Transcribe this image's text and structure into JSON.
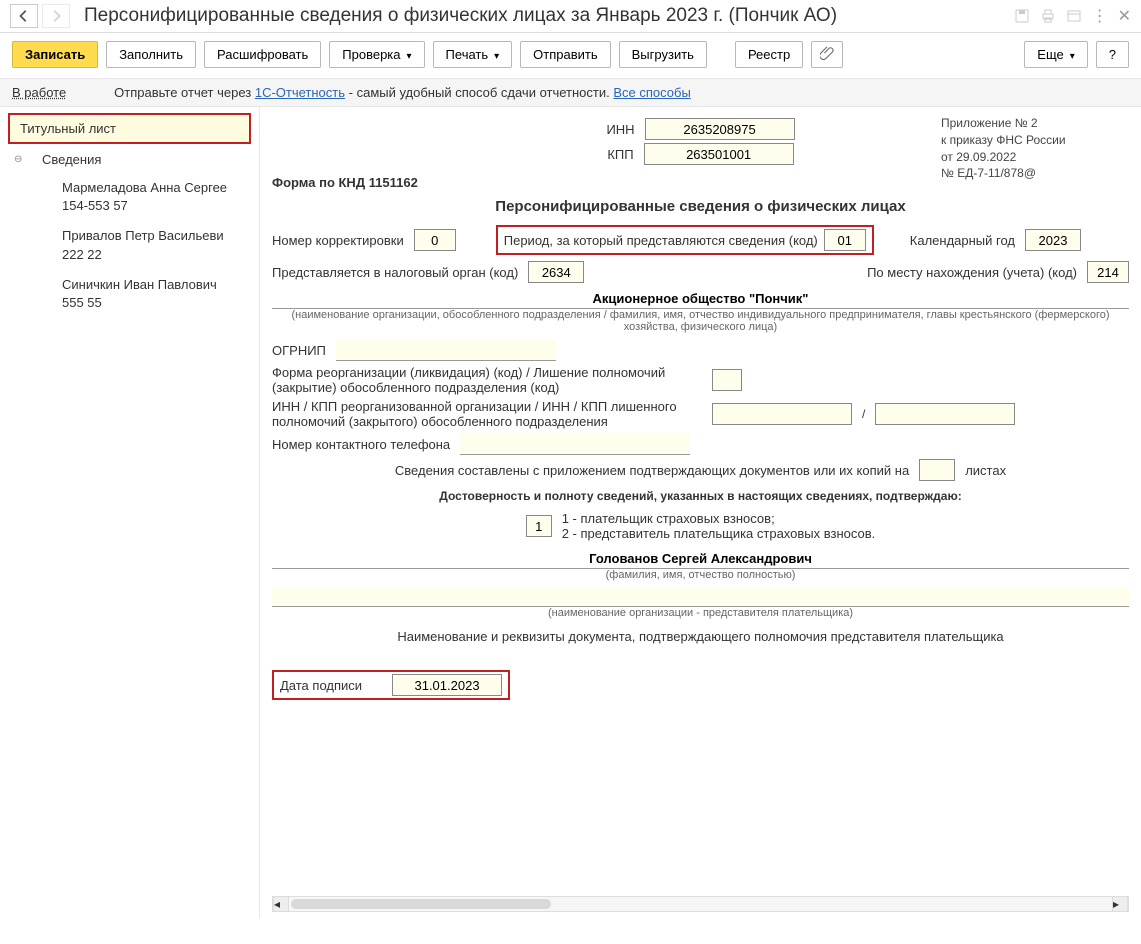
{
  "header": {
    "title": "Персонифицированные сведения о физических лицах за Январь 2023 г. (Пончик АО)"
  },
  "toolbar": {
    "save": "Записать",
    "fill": "Заполнить",
    "decode": "Расшифровать",
    "check": "Проверка",
    "print": "Печать",
    "send": "Отправить",
    "upload": "Выгрузить",
    "registry": "Реестр",
    "more": "Еще",
    "help": "?"
  },
  "infobar": {
    "status": "В работе",
    "text1": "Отправьте отчет через ",
    "link1": "1С-Отчетность",
    "text2": " - самый удобный способ сдачи отчетности. ",
    "link2": "Все способы"
  },
  "sidebar": {
    "title_sheet": "Титульный лист",
    "svedeniya": "Сведения",
    "people": [
      {
        "name": "Мармеладова Анна Сергее",
        "sub": "154-553 57"
      },
      {
        "name": "Привалов Петр Васильеви",
        "sub": "222 22"
      },
      {
        "name": "Синичкин Иван Павлович",
        "sub": "555 55"
      }
    ]
  },
  "form": {
    "inn_label": "ИНН",
    "inn": "2635208975",
    "kpp_label": "КПП",
    "kpp": "263501001",
    "reg": {
      "l1": "Приложение № 2",
      "l2": "к приказу ФНС России",
      "l3": "от 29.09.2022",
      "l4": "№ ЕД-7-11/878@"
    },
    "form_code_label": "Форма по КНД 1151162",
    "title": "Персонифицированные сведения о физических лицах",
    "corr_label": "Номер корректировки",
    "corr": "0",
    "period_label": "Период, за который представляются сведения (код)",
    "period": "01",
    "year_label": "Календарный год",
    "year": "2023",
    "tax_org_label": "Представляется в налоговый орган (код)",
    "tax_org": "2634",
    "place_label": "По месту нахождения (учета) (код)",
    "place": "214",
    "org_name": "Акционерное общество \"Пончик\"",
    "org_hint": "(наименование организации, обособленного подразделения / фамилия, имя, отчество индивидуального предпринимателя, главы крестьянского (фермерского) хозяйства, физического лица)",
    "ogrnip_label": "ОГРНИП",
    "reorg_label": "Форма реорганизации (ликвидация) (код) / Лишение полномочий (закрытие) обособленного подразделения (код)",
    "innkpp_reorg_label": "ИНН / КПП реорганизованной организации / ИНН / КПП лишенного полномочий (закрытого) обособленного подразделения",
    "phone_label": "Номер контактного телефона",
    "docs_attach": "Сведения составлены с приложением подтверждающих документов или их копий на",
    "sheets": "листах",
    "confirm_title": "Достоверность и полноту сведений, указанных в настоящих сведениях, подтверждаю:",
    "confirm_code": "1",
    "confirm_opt1": "1 - плательщик страховых взносов;",
    "confirm_opt2": "2 - представитель плательщика страховых взносов.",
    "signer": "Голованов Сергей Александрович",
    "signer_hint": "(фамилия, имя, отчество полностью)",
    "rep_org_hint": "(наименование организации - представителя плательщика)",
    "doc_label": "Наименование и реквизиты документа, подтверждающего полномочия представителя плательщика",
    "sign_date_label": "Дата подписи",
    "sign_date": "31.01.2023"
  }
}
